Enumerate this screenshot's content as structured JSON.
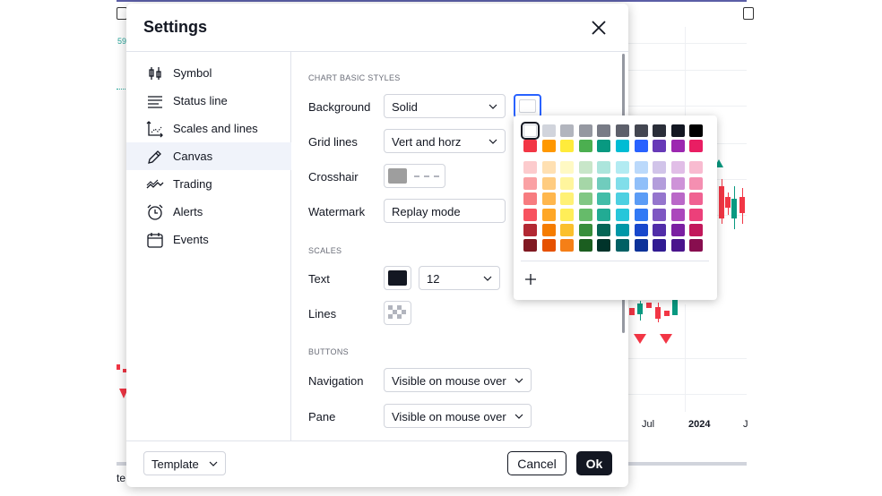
{
  "background_chart": {
    "partial_label": "59",
    "bottom_text": "te",
    "axis_labels": [
      {
        "text": "Jul",
        "bold": false
      },
      {
        "text": "2024",
        "bold": true
      },
      {
        "text": "J",
        "bold": false
      }
    ]
  },
  "dialog": {
    "title": "Settings",
    "sidebar": [
      {
        "label": "Symbol",
        "icon": "candlestick-icon"
      },
      {
        "label": "Status line",
        "icon": "status-line-icon"
      },
      {
        "label": "Scales and lines",
        "icon": "scales-icon"
      },
      {
        "label": "Canvas",
        "icon": "pencil-icon",
        "active": true
      },
      {
        "label": "Trading",
        "icon": "trading-icon"
      },
      {
        "label": "Alerts",
        "icon": "alarm-clock-icon"
      },
      {
        "label": "Events",
        "icon": "calendar-icon"
      }
    ],
    "sections": {
      "chart_basic_styles": "CHART BASIC STYLES",
      "scales": "SCALES",
      "buttons": "BUTTONS"
    },
    "rows": {
      "background": {
        "label": "Background",
        "value": "Solid",
        "color": "#ffffff"
      },
      "grid_lines": {
        "label": "Grid lines",
        "value": "Vert and horz"
      },
      "crosshair": {
        "label": "Crosshair",
        "color": "#9e9e9e"
      },
      "watermark": {
        "label": "Watermark",
        "value": "Replay mode"
      },
      "text": {
        "label": "Text",
        "color": "#131722",
        "value": "12"
      },
      "lines": {
        "label": "Lines"
      },
      "navigation": {
        "label": "Navigation",
        "value": "Visible on mouse over"
      },
      "pane": {
        "label": "Pane",
        "value": "Visible on mouse over"
      }
    },
    "footer": {
      "template": "Template",
      "cancel": "Cancel",
      "ok": "Ok"
    }
  },
  "color_picker": {
    "selected": "#ffffff",
    "palette": [
      [
        "#ffffff",
        "#d1d4dc",
        "#b2b5be",
        "#9598a1",
        "#787b86",
        "#5d606b",
        "#434651",
        "#2a2e39",
        "#131722",
        "#000000"
      ],
      [
        "#f23645",
        "#ff9800",
        "#ffeb3b",
        "#4caf50",
        "#089981",
        "#00bcd4",
        "#2962ff",
        "#673ab7",
        "#9c27b0",
        "#e91e63"
      ],
      [
        "#fccbcd",
        "#ffe0b2",
        "#fff9c4",
        "#c8e6c9",
        "#ace5dc",
        "#b2ebf2",
        "#bbd9fb",
        "#d1c4e9",
        "#e1bee7",
        "#f8bbd0"
      ],
      [
        "#faa1a4",
        "#ffcc80",
        "#fff59d",
        "#a5d6a7",
        "#70ccbd",
        "#80deea",
        "#90bff9",
        "#b39ddb",
        "#ce93d8",
        "#f48fb1"
      ],
      [
        "#f77c80",
        "#ffb74d",
        "#fff176",
        "#81c784",
        "#42bda8",
        "#4dd0e1",
        "#5b9cf6",
        "#9575cd",
        "#ba68c8",
        "#f06292"
      ],
      [
        "#f7525f",
        "#ffa726",
        "#ffee58",
        "#66bb6a",
        "#22ab94",
        "#26c6da",
        "#3179f5",
        "#7e57c2",
        "#ab47bc",
        "#ec407a"
      ],
      [
        "#b22833",
        "#f57c00",
        "#fbc02d",
        "#388e3c",
        "#056656",
        "#0097a7",
        "#1848cc",
        "#512da8",
        "#7b1fa2",
        "#c2185b"
      ],
      [
        "#801922",
        "#e65100",
        "#f57f17",
        "#1b5e20",
        "#00332a",
        "#006064",
        "#0c3299",
        "#311b92",
        "#4a148c",
        "#880e4f"
      ]
    ]
  }
}
